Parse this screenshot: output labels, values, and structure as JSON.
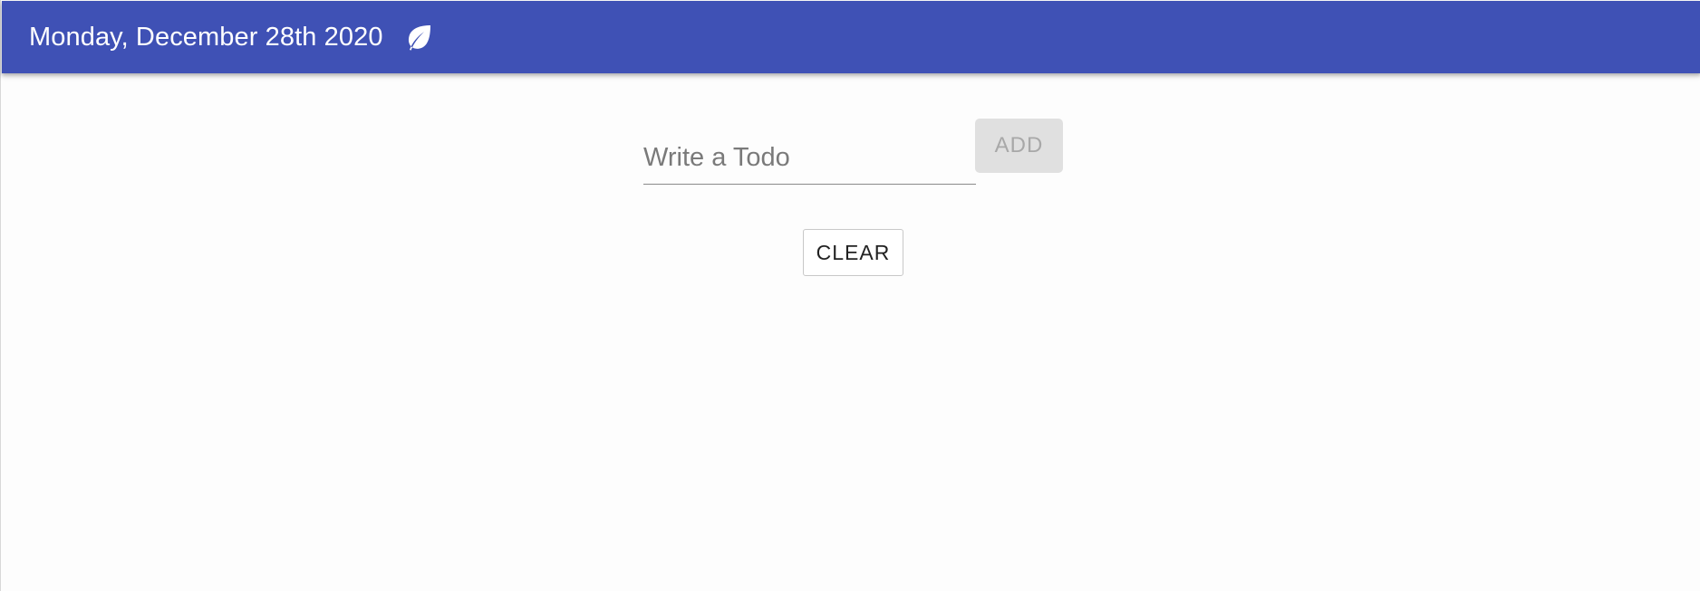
{
  "header": {
    "title": "Monday, December 28th 2020",
    "icon": "leaf-icon",
    "background_color": "#3f51b5"
  },
  "todo_form": {
    "input_placeholder": "Write a Todo",
    "input_value": "",
    "add_label": "ADD",
    "add_disabled": true
  },
  "actions": {
    "clear_label": "CLEAR"
  }
}
